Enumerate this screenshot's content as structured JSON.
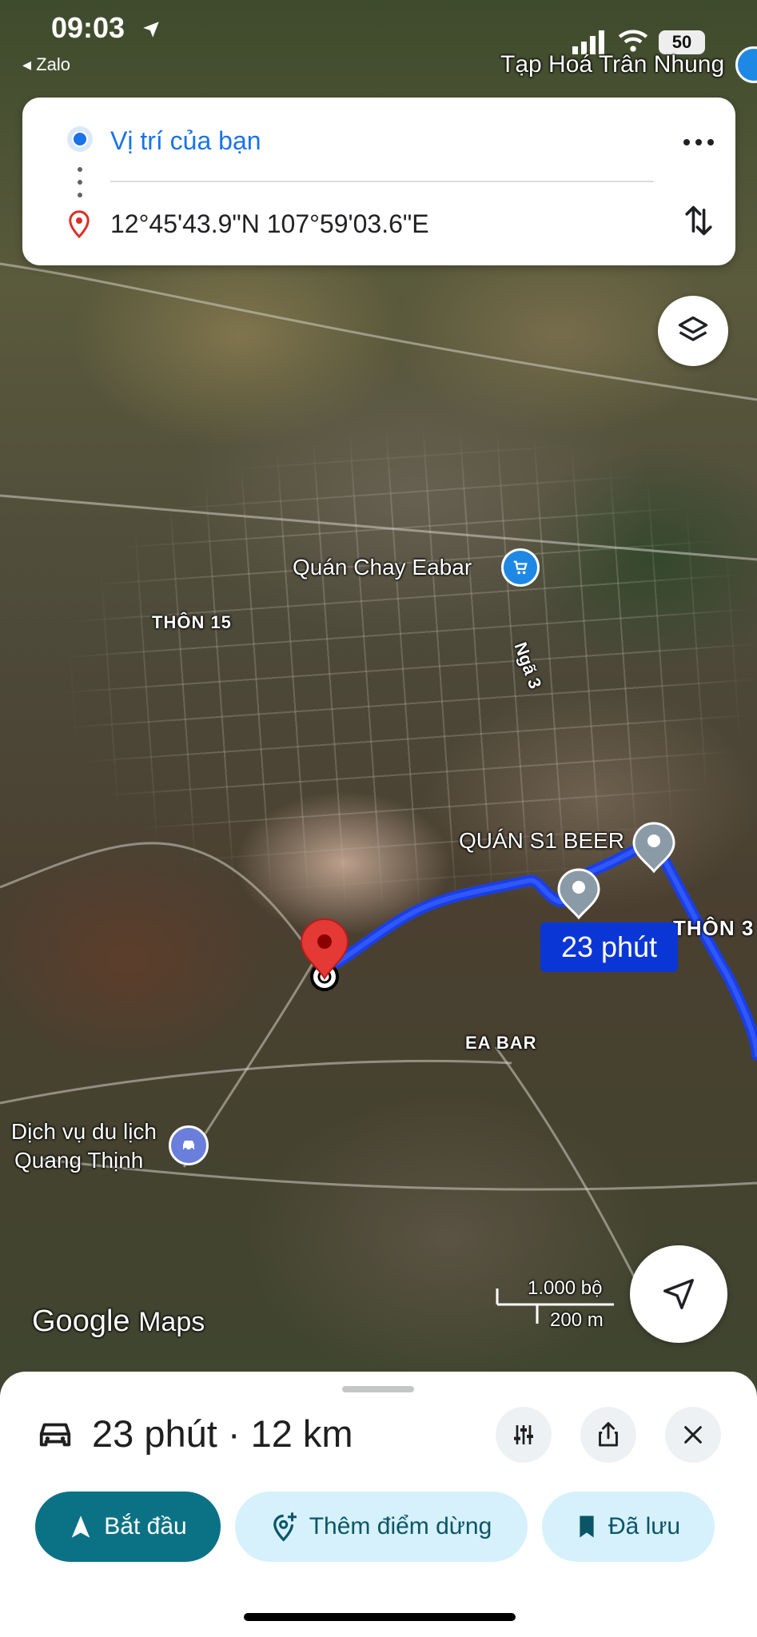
{
  "status_bar": {
    "time": "09:03",
    "back_app": "◂ Zalo",
    "battery": "50",
    "corner_place": "Tạp Hoá Trân Nhung"
  },
  "route_card": {
    "origin": "Vị trí của bạn",
    "destination": "12°45'43.9\"N 107°59'03.6\"E"
  },
  "map": {
    "labels": {
      "quan_chay": "Quán Chay Eabar",
      "thon_15": "THÔN 15",
      "nga_3": "Ngã 3",
      "quan_s1_beer": "QUÁN S1 BEER",
      "thon_3": "THÔN 3",
      "ea_bar": "EA BAR",
      "dich_vu_line1": "Dịch vụ du lịch",
      "dich_vu_line2": "Quang Thịnh"
    },
    "route_eta_badge": "23 phút",
    "scale_imperial": "1.000 bộ",
    "scale_metric": "200 m",
    "watermark_google": "Google",
    "watermark_maps": "Maps",
    "route_color": "#1a3fe6"
  },
  "bottom_sheet": {
    "summary": "23 phút · 12 km",
    "start_label": "Bắt đầu",
    "add_stop_label": "Thêm điểm dừng",
    "saved_label": "Đã lưu"
  },
  "colors": {
    "accent_blue": "#1a73e8",
    "start_button": "#0b7285",
    "chip_bg": "#d6f1fb"
  }
}
